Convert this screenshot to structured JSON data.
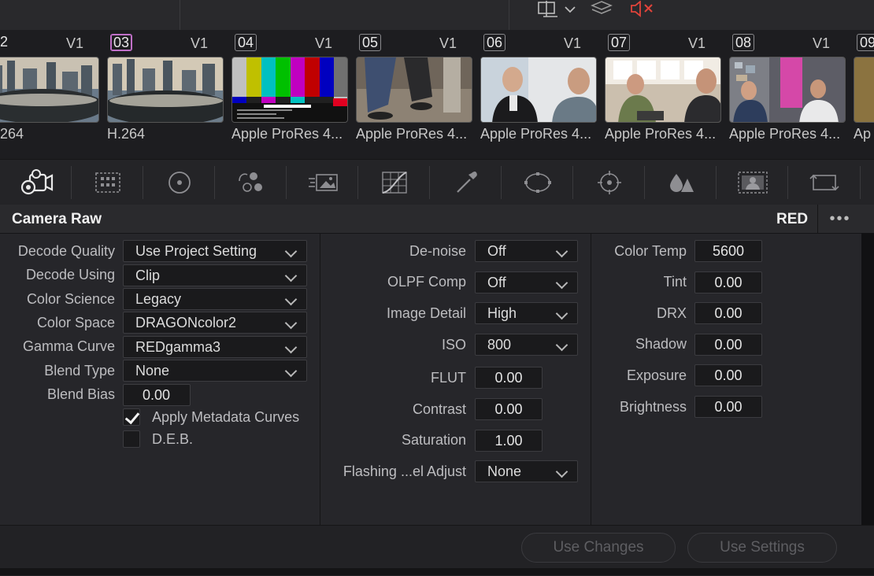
{
  "topbar": {
    "icons": [
      "wipe-icon",
      "chevron-down-icon",
      "layers-icon",
      "mute-icon"
    ],
    "mute_color": "#e0433a"
  },
  "clips": [
    {
      "number": "2",
      "track": "V1",
      "codec": "264",
      "selected": false
    },
    {
      "number": "03",
      "track": "V1",
      "codec": "H.264",
      "selected": true
    },
    {
      "number": "04",
      "track": "V1",
      "codec": "Apple ProRes 4...",
      "selected": false
    },
    {
      "number": "05",
      "track": "V1",
      "codec": "Apple ProRes 4...",
      "selected": false
    },
    {
      "number": "06",
      "track": "V1",
      "codec": "Apple ProRes 4...",
      "selected": false
    },
    {
      "number": "07",
      "track": "V1",
      "codec": "Apple ProRes 4...",
      "selected": false
    },
    {
      "number": "08",
      "track": "V1",
      "codec": "Apple ProRes 4...",
      "selected": false
    },
    {
      "number": "09",
      "track": "",
      "codec": "Ap",
      "selected": false
    }
  ],
  "tools": [
    "camera-raw-icon",
    "color-match-icon",
    "color-wheels-icon",
    "rgb-mixer-icon",
    "motion-effects-icon",
    "curves-icon",
    "qualifier-icon",
    "window-icon",
    "tracker-icon",
    "blur-icon",
    "key-icon",
    "sizing-icon"
  ],
  "panel": {
    "title": "Camera Raw",
    "format": "RED",
    "menu": "•••"
  },
  "left": {
    "decode_quality": {
      "label": "Decode Quality",
      "value": "Use Project Setting"
    },
    "decode_using": {
      "label": "Decode Using",
      "value": "Clip"
    },
    "color_science": {
      "label": "Color Science",
      "value": "Legacy"
    },
    "color_space": {
      "label": "Color Space",
      "value": "DRAGONcolor2"
    },
    "gamma_curve": {
      "label": "Gamma Curve",
      "value": "REDgamma3"
    },
    "blend_type": {
      "label": "Blend Type",
      "value": "None"
    },
    "blend_bias": {
      "label": "Blend Bias",
      "value": "0.00"
    },
    "apply_metadata_curves": {
      "label": "Apply Metadata Curves",
      "checked": true
    },
    "deb": {
      "label": "D.E.B.",
      "checked": false
    }
  },
  "middle": {
    "denoise": {
      "label": "De-noise",
      "value": "Off"
    },
    "olpf_comp": {
      "label": "OLPF Comp",
      "value": "Off"
    },
    "image_detail": {
      "label": "Image Detail",
      "value": "High"
    },
    "iso": {
      "label": "ISO",
      "value": "800"
    },
    "flut": {
      "label": "FLUT",
      "value": "0.00"
    },
    "contrast": {
      "label": "Contrast",
      "value": "0.00"
    },
    "saturation": {
      "label": "Saturation",
      "value": "1.00"
    },
    "flashing": {
      "label": "Flashing ...el Adjust",
      "value": "None"
    }
  },
  "right": {
    "color_temp": {
      "label": "Color Temp",
      "value": "5600"
    },
    "tint": {
      "label": "Tint",
      "value": "0.00"
    },
    "drx": {
      "label": "DRX",
      "value": "0.00"
    },
    "shadow": {
      "label": "Shadow",
      "value": "0.00"
    },
    "exposure": {
      "label": "Exposure",
      "value": "0.00"
    },
    "brightness": {
      "label": "Brightness",
      "value": "0.00"
    }
  },
  "footer": {
    "use_changes": "Use Changes",
    "use_settings": "Use Settings"
  }
}
